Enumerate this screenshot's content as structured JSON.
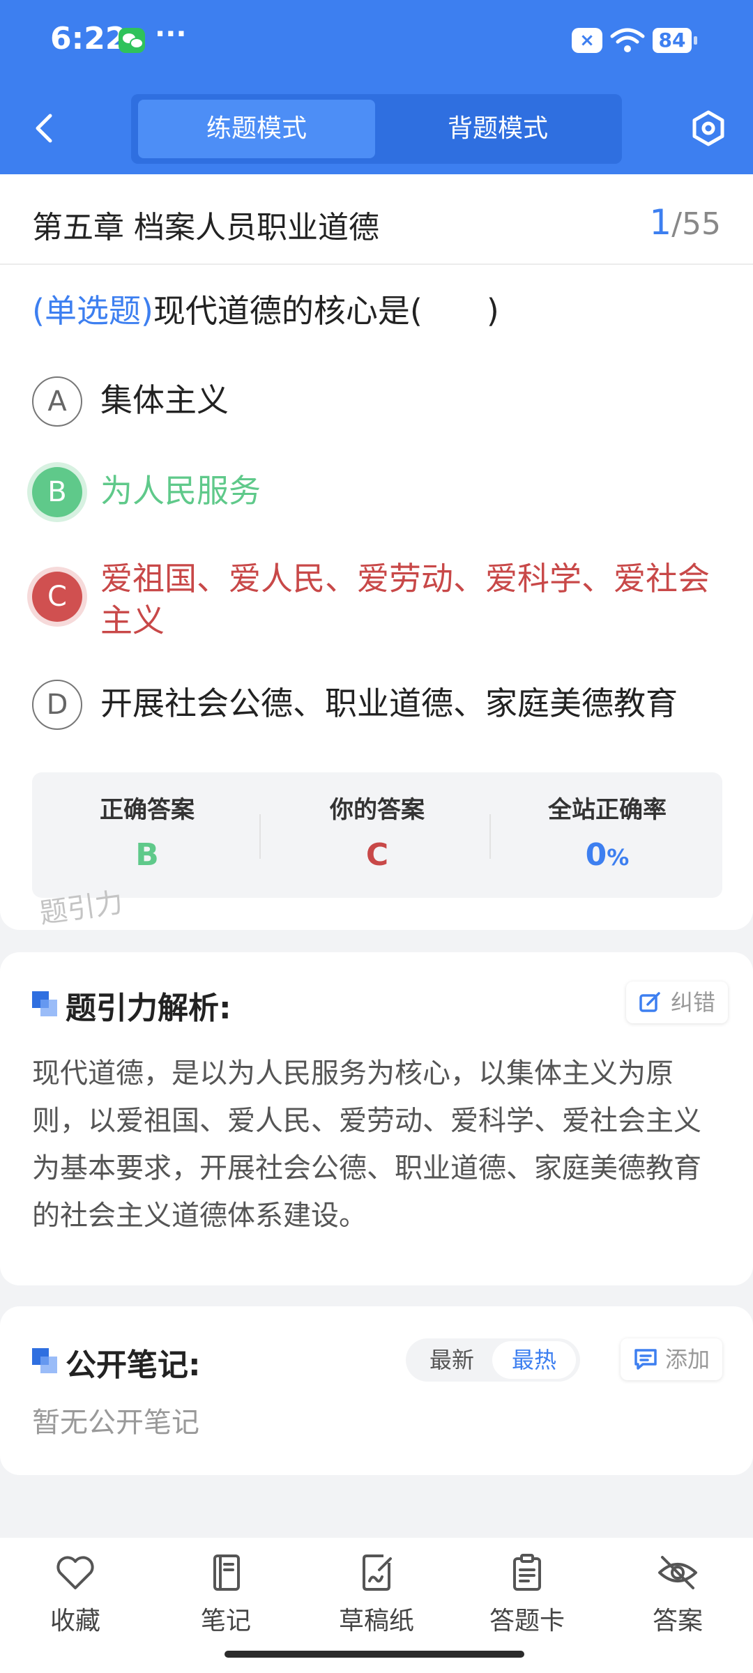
{
  "status_bar": {
    "time": "6:22",
    "more": "···",
    "notif_badge": "×",
    "battery": "84"
  },
  "header": {
    "tabs": [
      {
        "label": "练题模式",
        "active": true
      },
      {
        "label": "背题模式",
        "active": false
      }
    ]
  },
  "question": {
    "chapter": "第五章 档案人员职业道德",
    "current": "1",
    "total": "/55",
    "type": "(单选题)",
    "text": "现代道德的核心是(　　)",
    "options": [
      {
        "letter": "A",
        "text": "集体主义",
        "state": "normal"
      },
      {
        "letter": "B",
        "text": "为人民服务",
        "state": "correct"
      },
      {
        "letter": "C",
        "text": "爱祖国、爱人民、爱劳动、爱科学、爱社会主义",
        "state": "wrong"
      },
      {
        "letter": "D",
        "text": "开展社会公德、职业道德、家庭美德教育",
        "state": "normal"
      }
    ]
  },
  "answers": {
    "correct_label": "正确答案",
    "correct_value": "B",
    "yours_label": "你的答案",
    "yours_value": "C",
    "rate_label": "全站正确率",
    "rate_value": "0",
    "rate_unit": "%"
  },
  "watermark": "题引力",
  "analysis": {
    "title": "题引力解析:",
    "report_label": "纠错",
    "text": "现代道德，是以为人民服务为核心，以集体主义为原则，以爱祖国、爱人民、爱劳动、爱科学、爱社会主义为基本要求，开展社会公德、职业道德、家庭美德教育的社会主义道德体系建设。"
  },
  "notes": {
    "title": "公开笔记:",
    "sort_newest": "最新",
    "sort_hottest": "最热",
    "add_label": "添加",
    "empty": "暂无公开笔记"
  },
  "bottom_bar": {
    "items": [
      {
        "label": "收藏",
        "icon": "heart-icon"
      },
      {
        "label": "笔记",
        "icon": "notebook-icon"
      },
      {
        "label": "草稿纸",
        "icon": "draft-paper-icon"
      },
      {
        "label": "答题卡",
        "icon": "answer-sheet-icon"
      },
      {
        "label": "答案",
        "icon": "eye-off-icon"
      }
    ]
  },
  "colors": {
    "primary": "#3d7ff0",
    "correct": "#5fc98a",
    "wrong": "#c84848"
  }
}
